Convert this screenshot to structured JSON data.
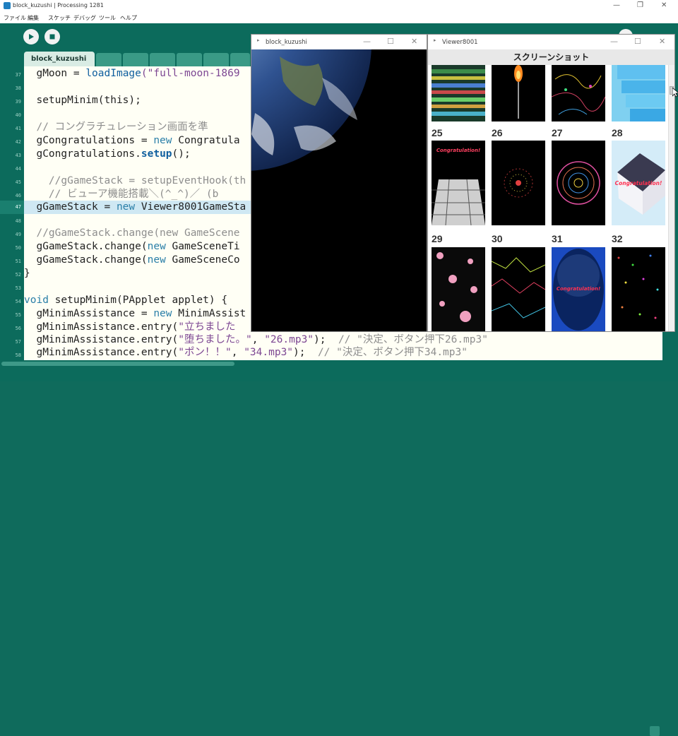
{
  "ide": {
    "title": "block_kuzushi | Processing 1281",
    "menu": [
      "ファイル",
      "編集",
      "スケッチ",
      "デバッグ",
      "ツール",
      "ヘルプ"
    ],
    "active_tab": "block_kuzushi",
    "line_numbers": [
      "37",
      "38",
      "39",
      "40",
      "41",
      "42",
      "43",
      "44",
      "45",
      "46",
      "47",
      "48",
      "49",
      "50",
      "51",
      "52",
      "53",
      "54",
      "55",
      "56",
      "57",
      "58"
    ],
    "highlighted_line": "47",
    "code": {
      "l37a": "  gMoon = ",
      "l37b": "loadImage",
      "l37c": "(\"full-moon-1869",
      "l39": "  setupMinim(this);",
      "l41": "  // コングラチュレーション画面を準",
      "l42a": "  gCongratulations = ",
      "l42b": "new",
      "l42c": " Congratula",
      "l43a": "  gCongratulations.",
      "l43b": "setup",
      "l43c": "();",
      "l45": "    //gGameStack = setupEventHook(th",
      "l46": "    // ビューア機能搭載＼(^_^)／ (b",
      "l47a": "  gGameStack = ",
      "l47b": "new",
      "l47c": " Viewer8001GameSta",
      "l49": "  //gGameStack.change(new GameScene",
      "l50a": "  gGameStack.change(",
      "l50b": "new",
      "l50c": " GameSceneTi",
      "l51a": "  gGameStack.change(",
      "l51b": "new",
      "l51c": " GameSceneCo",
      "l52": "}",
      "l54a": "void",
      "l54b": " setupMinim(PApplet applet) {",
      "l55a": "  gMinimAssistance = ",
      "l55b": "new",
      "l55c": " MinimAssist",
      "l56a": "  gMinimAssistance.entry(",
      "l56b": "\"立ちました",
      "l57a": "  gMinimAssistance.entry(",
      "l57b": "\"堕ちました。\"",
      "l57c": ", ",
      "l57d": "\"26.mp3\"",
      "l57e": ");  ",
      "l57f": "// \"決定、ボタン押下26.mp3\"",
      "l58a": "  gMinimAssistance.entry(",
      "l58b": "\"ポン！！\"",
      "l58c": ", ",
      "l58d": "\"34.mp3\"",
      "l58e": ");  ",
      "l58f": "// \"決定、ボタン押下34.mp3\""
    }
  },
  "sketch_window": {
    "title": "block_kuzushi"
  },
  "viewer_window": {
    "title": "Viewer8001",
    "header": "スクリーンショット",
    "thumbnails": [
      {
        "num": "25",
        "caption": "Congratulation!"
      },
      {
        "num": "26",
        "caption": ""
      },
      {
        "num": "27",
        "caption": ""
      },
      {
        "num": "28",
        "caption": "Congratulation!"
      },
      {
        "num": "29",
        "caption": ""
      },
      {
        "num": "30",
        "caption": ""
      },
      {
        "num": "31",
        "caption": "Congratulation!"
      },
      {
        "num": "32",
        "caption": ""
      }
    ]
  },
  "colors": {
    "ide_green": "#0c6b5c",
    "editor_bg": "#fffff5",
    "highlight": "#cfe8f3"
  }
}
